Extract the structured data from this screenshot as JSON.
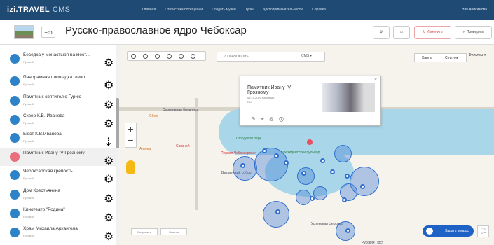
{
  "topnav": {
    "brand": "izi.TRAVEL",
    "cms": "CMS",
    "links": [
      "Главная",
      "Статистика посещений",
      "Создать музей",
      "Туры",
      "Достопримечательности",
      "Справка"
    ],
    "user": "Эля Анисимова"
  },
  "title": {
    "lang": "+ф",
    "text": "Русско-православное ядро Чебоксар",
    "edit_button": "Изменить",
    "check_button": "Проверить"
  },
  "sidebar": {
    "items": [
      {
        "num": "",
        "label": "Беседка у монастыря на мест...",
        "sub": "Русский"
      },
      {
        "num": "",
        "label": "Панорамная площадка: лево...",
        "sub": "Русский"
      },
      {
        "num": "",
        "label": "Памятник святителю Гурию",
        "sub": "Русский"
      },
      {
        "num": "",
        "label": "Сквер К.В. Иванова",
        "sub": "Русский"
      },
      {
        "num": "",
        "label": "Бюст К.В.Иванова",
        "sub": "Русский"
      },
      {
        "num": "",
        "label": "Памятник Ивану IV Грозному",
        "sub": "Русский"
      },
      {
        "num": "",
        "label": "Чебоксарская крепость",
        "sub": "Русский"
      },
      {
        "num": "",
        "label": "Дом Крестьянина",
        "sub": "Русский"
      },
      {
        "num": "",
        "label": "Кинотеатр \"Родина\"",
        "sub": "Русский"
      },
      {
        "num": "",
        "label": "Храм Михаила Архангела",
        "sub": "Русский"
      }
    ]
  },
  "map": {
    "search_placeholder": "Поиск в CMS",
    "cms_badge": "CMS",
    "map_tab": "Карта",
    "sat_tab": "Спутник",
    "filters": "Фильтры",
    "ask": "Задать вопрос",
    "bottom_buttons": [
      "Сохранить",
      "Отмена"
    ]
  },
  "popup": {
    "title": "Памятник Ивану IV Грозному",
    "date": "06.10.2021 на ревью",
    "lang": "RU"
  }
}
